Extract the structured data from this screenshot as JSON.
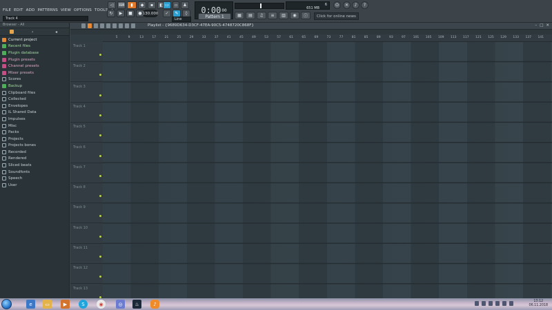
{
  "menu": [
    "FILE",
    "EDIT",
    "ADD",
    "PATTERNS",
    "VIEW",
    "OPTIONS",
    "TOOLS",
    "?"
  ],
  "hint": "Track 4",
  "toolbar": {
    "tempo": "130.000",
    "time_main": "0:00",
    "time_sub": "00",
    "pattern": "Pattern 1",
    "snap": "Line",
    "cpu_value": "6",
    "mem_value": "651 MB",
    "mem_sub": "0",
    "news": "Click for online news"
  },
  "browser": {
    "header": "Browser - All",
    "items": [
      {
        "label": "Current project",
        "kind": "project"
      },
      {
        "label": "Recent files",
        "kind": "green"
      },
      {
        "label": "Plugin database",
        "kind": "green"
      },
      {
        "label": "Plugin presets",
        "kind": "pink"
      },
      {
        "label": "Channel presets",
        "kind": "pink"
      },
      {
        "label": "Mixer presets",
        "kind": "pink"
      },
      {
        "label": "Scores",
        "kind": "folder"
      },
      {
        "label": "Backup",
        "kind": "green"
      },
      {
        "label": "Clipboard files",
        "kind": "folder"
      },
      {
        "label": "Collected",
        "kind": "folder"
      },
      {
        "label": "Envelopes",
        "kind": "folder"
      },
      {
        "label": "IL Shared Data",
        "kind": "folder"
      },
      {
        "label": "Impulses",
        "kind": "folder"
      },
      {
        "label": "Misc",
        "kind": "folder"
      },
      {
        "label": "Packs",
        "kind": "folder"
      },
      {
        "label": "Projects",
        "kind": "folder"
      },
      {
        "label": "Projects bones",
        "kind": "folder"
      },
      {
        "label": "Recorded",
        "kind": "folder"
      },
      {
        "label": "Rendered",
        "kind": "folder"
      },
      {
        "label": "Sliced beats",
        "kind": "folder"
      },
      {
        "label": "Soundfonts",
        "kind": "folder"
      },
      {
        "label": "Speech",
        "kind": "folder"
      },
      {
        "label": "User",
        "kind": "folder"
      }
    ]
  },
  "playlist": {
    "title": "Playlist - {9689D634-D3CF-47EA-90C5-4748720C868F}",
    "ruler": [
      "5",
      "9",
      "13",
      "17",
      "21",
      "25",
      "29",
      "33",
      "37",
      "41",
      "45",
      "49",
      "53",
      "57",
      "61",
      "65",
      "69",
      "73",
      "77",
      "81",
      "85",
      "89",
      "93",
      "97",
      "101",
      "105",
      "109",
      "113",
      "117",
      "121",
      "125",
      "129",
      "133",
      "137",
      "141"
    ],
    "tracks": [
      "Track 1",
      "Track 2",
      "Track 3",
      "Track 4",
      "Track 5",
      "Track 6",
      "Track 7",
      "Track 8",
      "Track 9",
      "Track 10",
      "Track 11",
      "Track 12",
      "Track 13"
    ]
  },
  "taskbar": {
    "time": "13:12",
    "date": "06.11.2018"
  }
}
